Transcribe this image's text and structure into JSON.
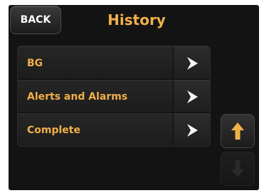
{
  "header": {
    "back_label": "BACK",
    "title": "History"
  },
  "menu": {
    "items": [
      {
        "label": "BG",
        "icon": "chevron-right-icon"
      },
      {
        "label": "Alerts and Alarms",
        "icon": "chevron-right-icon"
      },
      {
        "label": "Complete",
        "icon": "chevron-right-icon"
      }
    ]
  },
  "scroll": {
    "up_icon": "arrow-up-icon",
    "down_icon": "arrow-down-icon",
    "down_enabled": false
  },
  "colors": {
    "accent": "#f0b04a",
    "background": "#131313",
    "button_text": "#ffffff",
    "disabled_icon": "#2a2a2a"
  }
}
